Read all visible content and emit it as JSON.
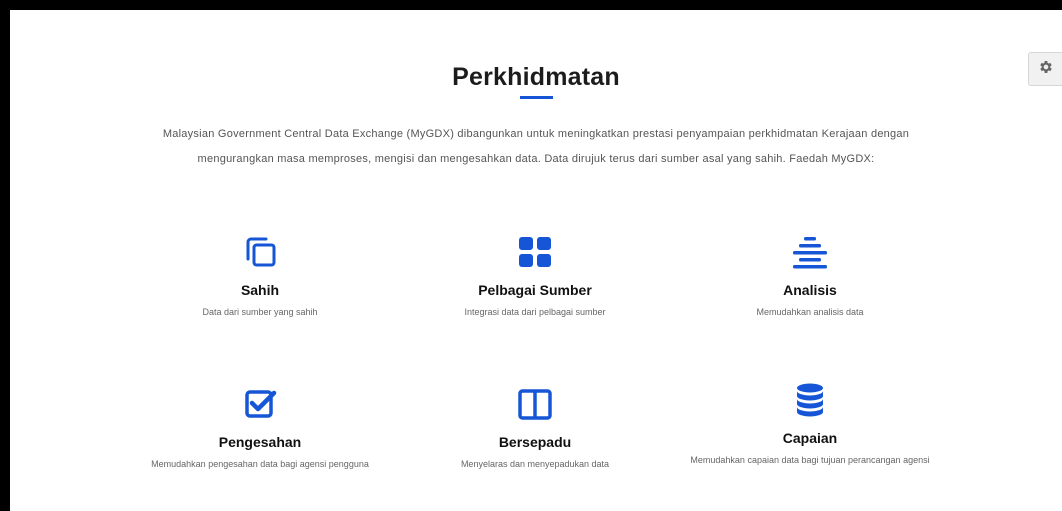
{
  "page": {
    "title": "Perkhidmatan",
    "intro_line1": "Malaysian Government Central Data Exchange (MyGDX) dibangunkan untuk meningkatkan prestasi penyampaian perkhidmatan Kerajaan dengan",
    "intro_line2": "mengurangkan masa memproses, mengisi dan mengesahkan data. Data dirujuk terus dari sumber asal yang sahih. Faedah MyGDX:"
  },
  "colors": {
    "accent": "#1656d6"
  },
  "features": [
    {
      "icon": "copy-icon",
      "title": "Sahih",
      "description": "Data dari sumber yang sahih"
    },
    {
      "icon": "grid-icon",
      "title": "Pelbagai Sumber",
      "description": "Integrasi data dari pelbagai sumber"
    },
    {
      "icon": "align-center-icon",
      "title": "Analisis",
      "description": "Memudahkan analisis data"
    },
    {
      "icon": "checkbox-icon",
      "title": "Pengesahan",
      "description": "Memudahkan pengesahan data bagi agensi pengguna"
    },
    {
      "icon": "columns-icon",
      "title": "Bersepadu",
      "description": "Menyelaras dan menyepadukan data"
    },
    {
      "icon": "database-icon",
      "title": "Capaian",
      "description": "Memudahkan capaian data bagi tujuan perancangan agensi"
    }
  ],
  "settings": {
    "icon": "gear-icon"
  }
}
